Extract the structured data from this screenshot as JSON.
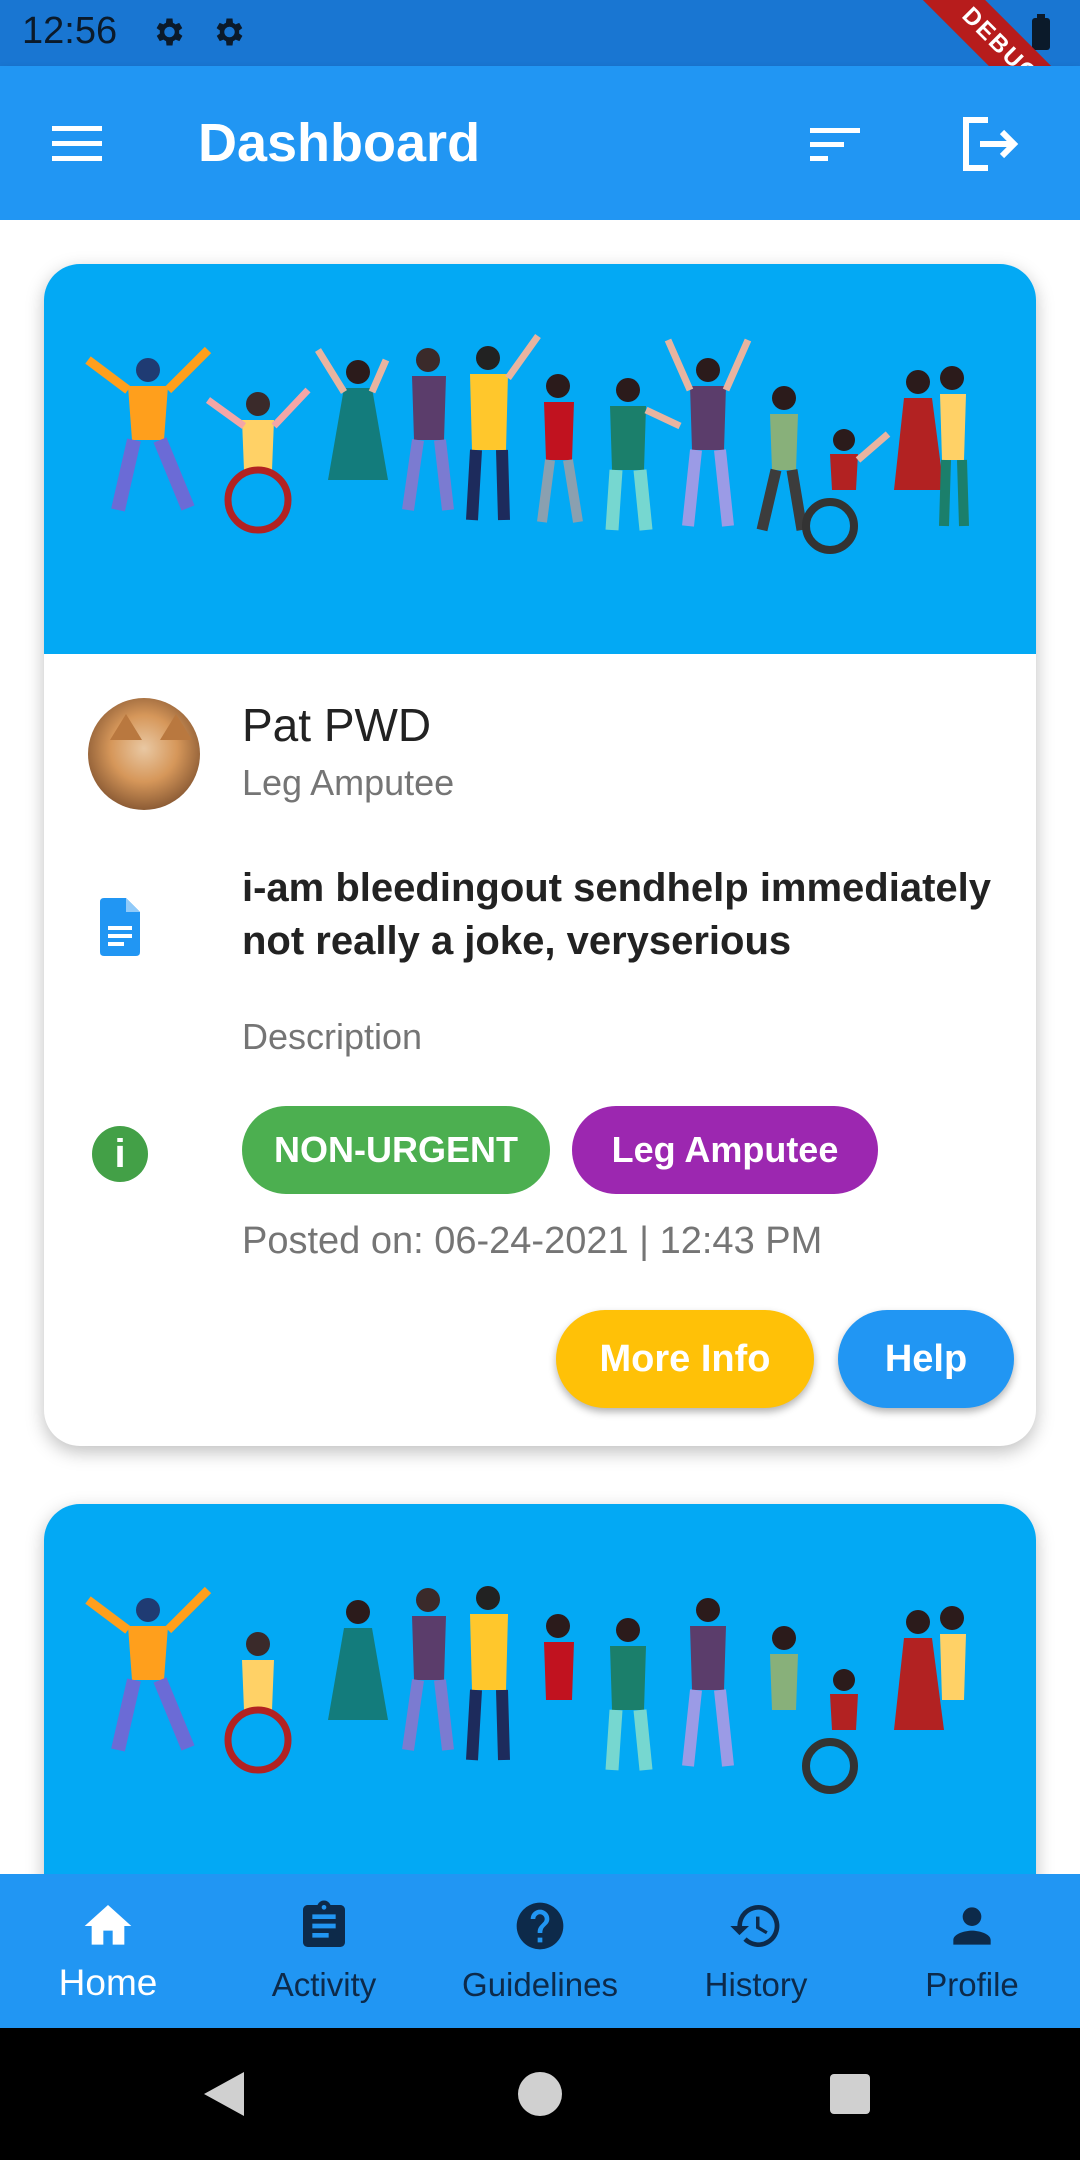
{
  "status_bar": {
    "time": "12:56",
    "debug_label": "DEBUG"
  },
  "app_bar": {
    "title": "Dashboard"
  },
  "post": {
    "user_name": "Pat PWD",
    "user_disability": "Leg Amputee",
    "description": "i-am bleedingout sendhelp immediately not really a joke, veryserious",
    "description_label": "Description",
    "urgency": "NON-URGENT",
    "category": "Leg Amputee",
    "posted_on": "Posted on: 06-24-2021 | 12:43 PM",
    "more_info_label": "More Info",
    "help_label": "Help"
  },
  "bottom_nav": {
    "items": [
      {
        "label": "Home",
        "icon": "home-icon",
        "active": true
      },
      {
        "label": "Activity",
        "icon": "clipboard-icon",
        "active": false
      },
      {
        "label": "Guidelines",
        "icon": "help-circle-icon",
        "active": false
      },
      {
        "label": "History",
        "icon": "history-icon",
        "active": false
      },
      {
        "label": "Profile",
        "icon": "person-icon",
        "active": false
      }
    ]
  },
  "colors": {
    "primary": "#2196f3",
    "banner": "#03a9f4",
    "urgency_chip": "#4caf50",
    "category_chip": "#9c27b0",
    "more_info_button": "#ffc107",
    "info_icon": "#43a047"
  }
}
